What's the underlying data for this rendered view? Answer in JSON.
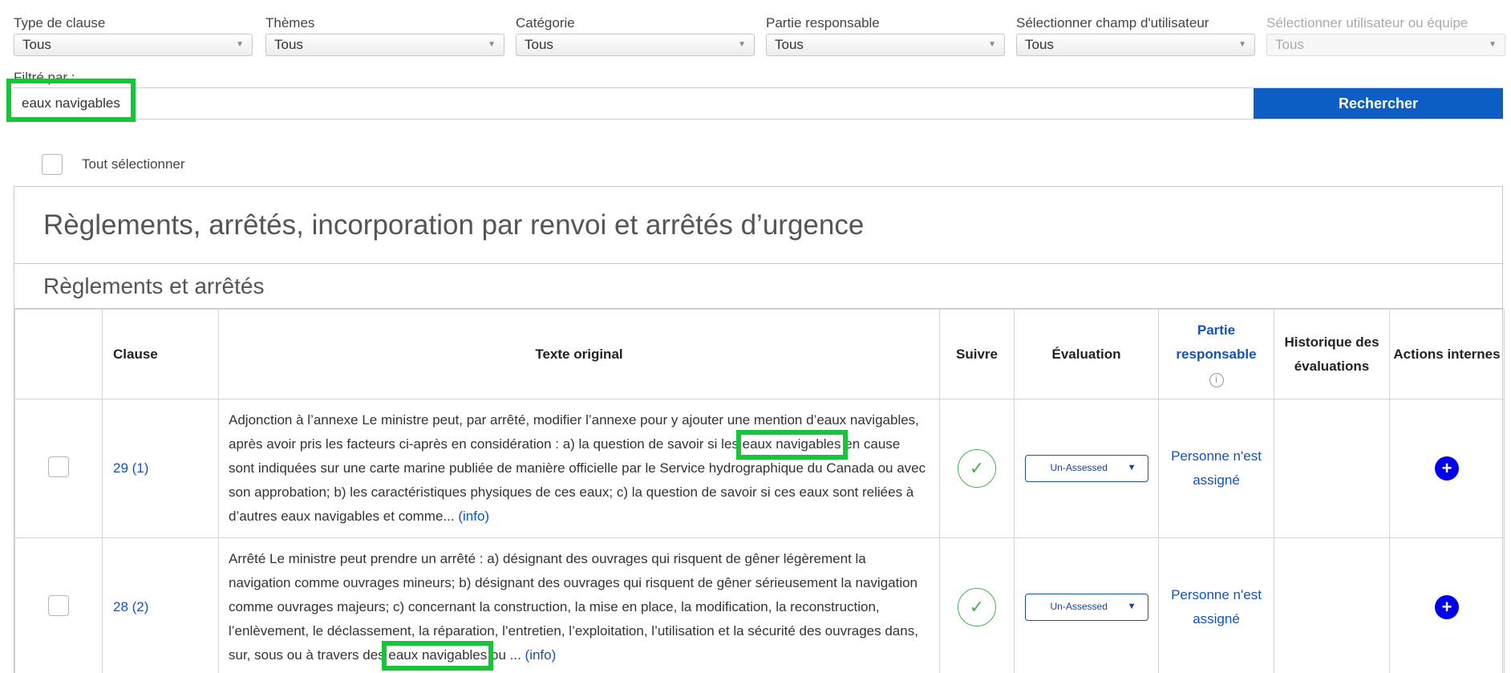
{
  "filters": [
    {
      "label": "Type de clause",
      "value": "Tous"
    },
    {
      "label": "Thèmes",
      "value": "Tous"
    },
    {
      "label": "Catégorie",
      "value": "Tous"
    },
    {
      "label": "Partie responsable",
      "value": "Tous"
    },
    {
      "label": "Sélectionner champ d'utilisateur",
      "value": "Tous"
    },
    {
      "label": "Sélectionner utilisateur ou équipe",
      "value": "Tous",
      "disabled": true
    }
  ],
  "search": {
    "label": "Filtré par :",
    "value": "eaux navigables",
    "button_label": "Rechercher"
  },
  "select_all_label": "Tout sélectionner",
  "section": {
    "title": "Règlements, arrêtés, incorporation par renvoi et arrêtés d’urgence",
    "subtitle": "Règlements et arrêtés"
  },
  "table": {
    "headers": {
      "clause": "Clause",
      "texte": "Texte original",
      "suivre": "Suivre",
      "evaluation": "Évaluation",
      "partie": "Partie responsable",
      "historique": "Historique des évaluations",
      "actions": "Actions internes"
    },
    "rows": [
      {
        "clause": "29 (1)",
        "text_before": "Adjonction à l’annexe Le ministre peut, par arrêté, modifier l’annexe pour y ajouter une mention d’eaux navigables, après avoir pris les facteurs ci-après en considération : a) la question de savoir si les ",
        "text_highlight": "eaux navigables",
        "text_after": " en cause sont indiquées sur une carte marine publiée de manière officielle par le Service hydrographique du Canada ou avec son approbation; b) les caractéristiques physiques de ces eaux; c) la question de savoir si ces eaux sont reliées à d’autres eaux navigables et comme...",
        "info_link": "(info)",
        "evaluation": "Un-Assessed",
        "partie": "Personne n'est assigné",
        "historique": ""
      },
      {
        "clause": "28 (2)",
        "text_before": "Arrêté Le ministre peut prendre un arrêté : a) désignant des ouvrages qui risquent de gêner légèrement la navigation comme ouvrages mineurs; b) désignant des ouvrages qui risquent de gêner sérieusement la navigation comme ouvrages majeurs; c) concernant la construction, la mise en place, la modification, la reconstruction, l’enlèvement, le déclassement, la réparation, l’entretien, l’exploitation, l’utilisation et la sécurité des ouvrages dans, sur, sous ou à travers des ",
        "text_highlight": "eaux navigables",
        "text_after": " ou ...",
        "info_link": "(info)",
        "evaluation": "Un-Assessed",
        "partie": "Personne n'est assigné",
        "historique": ""
      }
    ]
  },
  "colors": {
    "accent": "#0d5ec4",
    "link": "#1552b8",
    "highlight": "#19c43a",
    "check": "#4caf50"
  }
}
